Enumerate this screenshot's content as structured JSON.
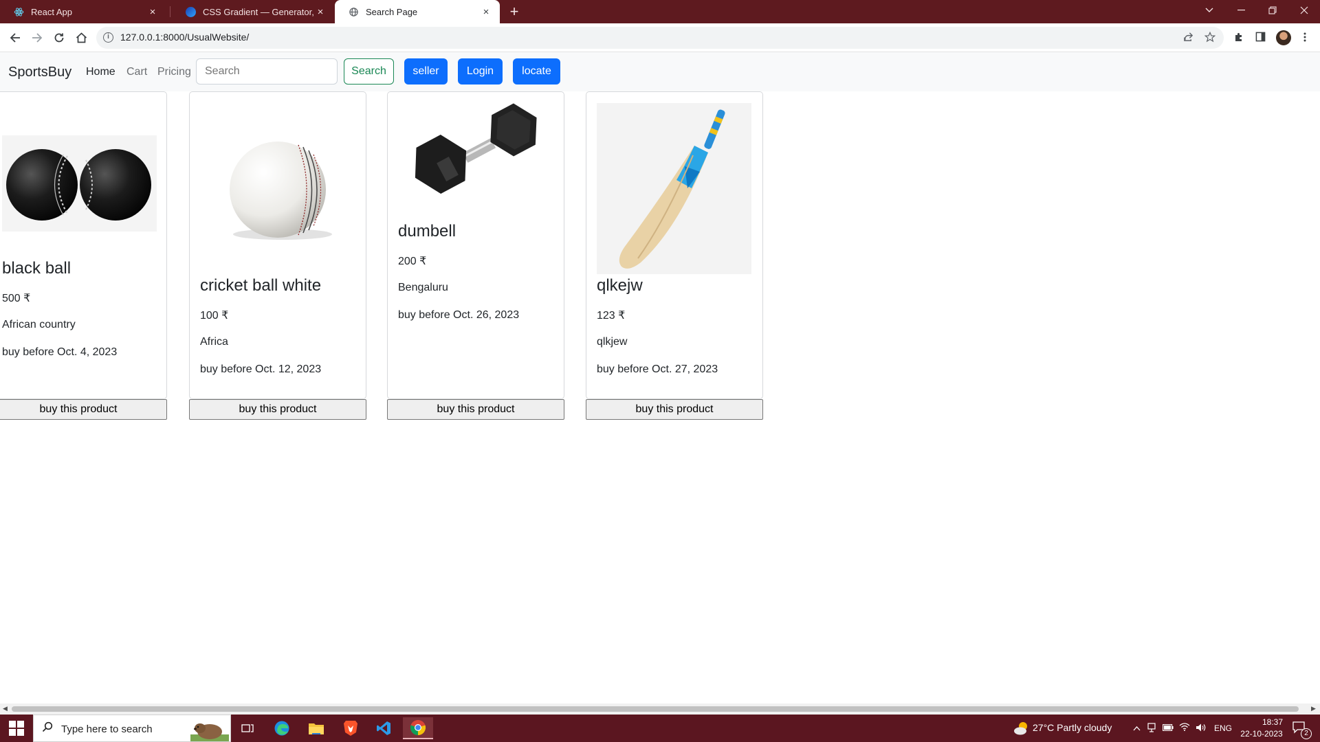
{
  "browser": {
    "tabs": [
      {
        "title": "React App",
        "active": false
      },
      {
        "title": "CSS Gradient — Generator, Mak",
        "active": false
      },
      {
        "title": "Search Page",
        "active": true
      }
    ],
    "url": "127.0.0.1:8000/UsualWebsite/",
    "new_tab_glyph": "+",
    "close_glyph": "×"
  },
  "navbar": {
    "brand": "SportsBuy",
    "links": [
      "Home",
      "Cart",
      "Pricing"
    ],
    "search_placeholder": "Search",
    "search_button": "Search",
    "seller_button": "seller",
    "login_button": "Login",
    "locate_button": "locate"
  },
  "products": [
    {
      "name": "black ball",
      "price": "500 ₹",
      "location": "African country",
      "buy_before": "buy before Oct. 4, 2023",
      "button": "buy this product",
      "image_icon": "black-cricket-balls"
    },
    {
      "name": "cricket ball white",
      "price": "100 ₹",
      "location": "Africa",
      "buy_before": "buy before Oct. 12, 2023",
      "button": "buy this product",
      "image_icon": "white-cricket-ball"
    },
    {
      "name": "dumbell",
      "price": "200 ₹",
      "location": "Bengaluru",
      "buy_before": "buy before Oct. 26, 2023",
      "button": "buy this product",
      "image_icon": "dumbbell"
    },
    {
      "name": "qlkejw",
      "price": "123 ₹",
      "location": "qlkjew",
      "buy_before": "buy before Oct. 27, 2023",
      "button": "buy this product",
      "image_icon": "cricket-bat"
    }
  ],
  "taskbar": {
    "search_placeholder": "Type here to search",
    "weather": "27°C  Partly cloudy",
    "language": "ENG",
    "time": "18:37",
    "date": "22-10-2023",
    "notifications": "2"
  },
  "colors": {
    "tabstrip": "#5e1a1f",
    "taskbar": "#5b1620",
    "primary": "#0d6efd",
    "success": "#198754"
  }
}
